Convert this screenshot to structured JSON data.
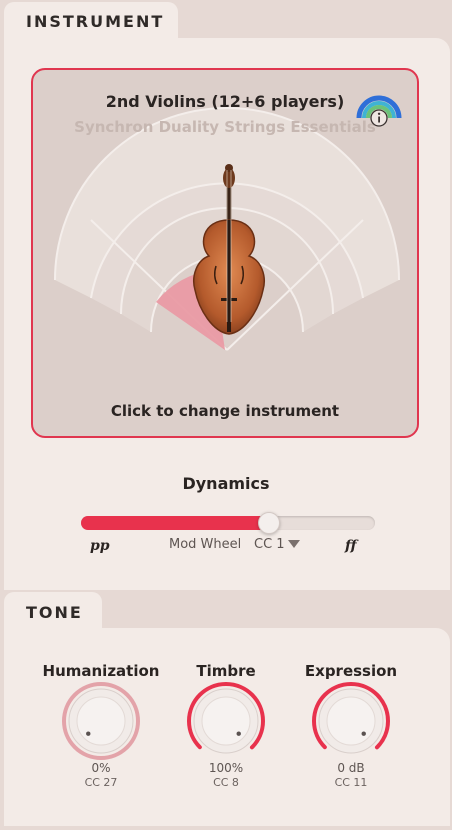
{
  "instrument_tab": {
    "label": "INSTRUMENT"
  },
  "instrument": {
    "name": "2nd Violins (12+6 players)",
    "library": "Synchron Duality Strings Essentials",
    "change_label": "Click to change instrument",
    "info_icon": "info-icon"
  },
  "dynamics": {
    "title": "Dynamics",
    "min_label": "pp",
    "max_label": "ff",
    "controller_label": "Mod Wheel",
    "cc_label": "CC 1",
    "value": 0.63,
    "accent": "#e8324d"
  },
  "tone_tab": {
    "label": "TONE"
  },
  "tone": {
    "knobs": [
      {
        "title": "Humanization",
        "value": "0%",
        "cc": "CC 27",
        "level": 0.0
      },
      {
        "title": "Timbre",
        "value": "100%",
        "cc": "CC 8",
        "level": 1.0
      },
      {
        "title": "Expression",
        "value": "0 dB",
        "cc": "CC 11",
        "level": 1.0
      }
    ]
  },
  "colors": {
    "accent": "#e8324d",
    "panel": "#f3ebe7",
    "frame": "#e6d9d4"
  }
}
